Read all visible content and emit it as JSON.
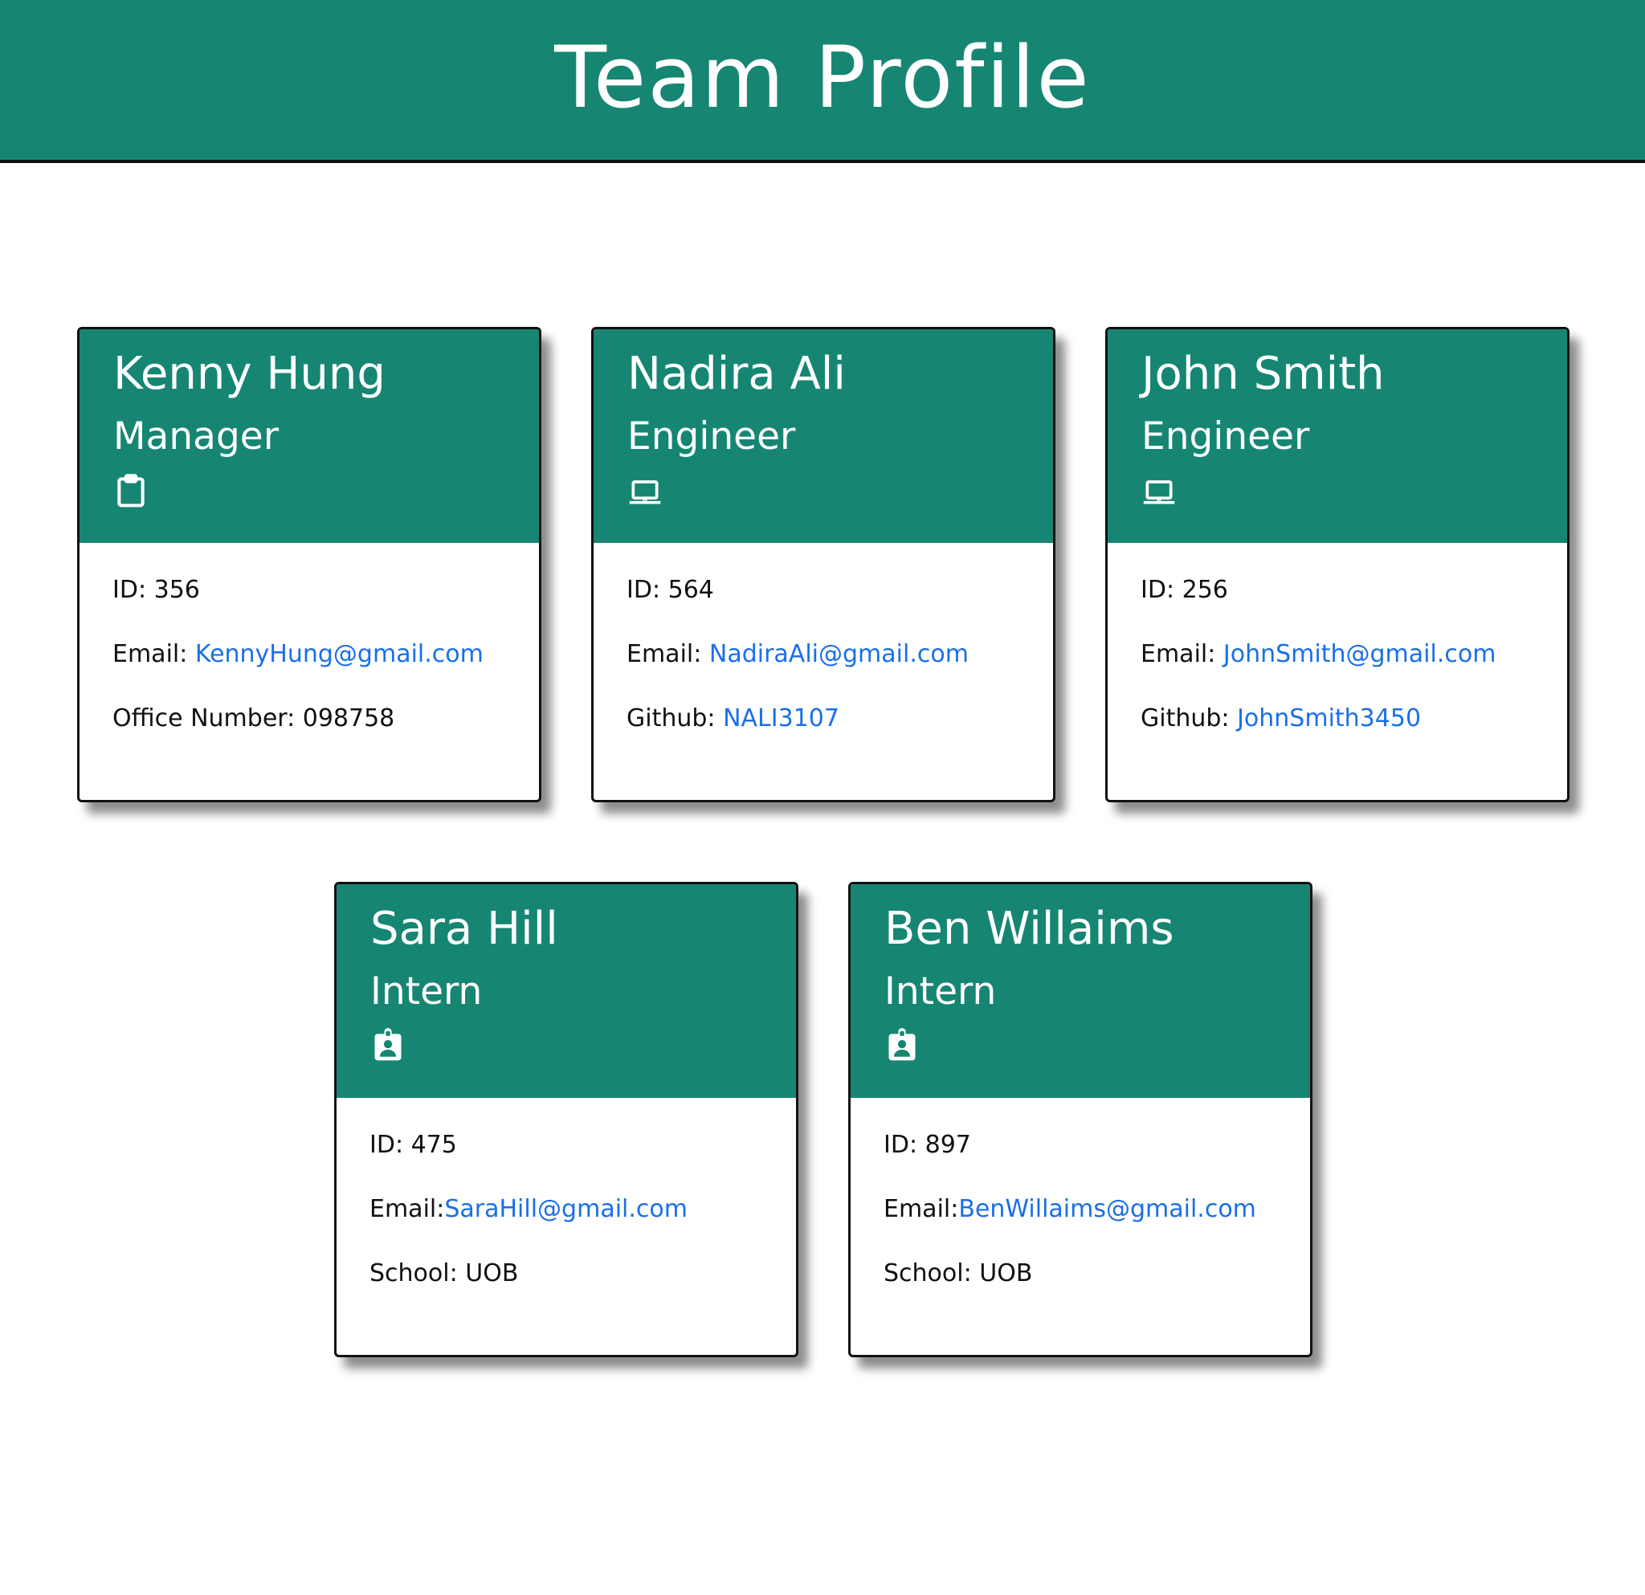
{
  "header": {
    "title": "Team Profile"
  },
  "colors": {
    "accent": "#168673",
    "link": "#1a6fe8"
  },
  "cards": [
    {
      "name": "Kenny Hung",
      "role": "Manager",
      "icon": "clipboard-icon",
      "id_label": "ID:",
      "id_value": "356",
      "email_label": "Email:",
      "email_value": "KennyHung@gmail.com",
      "extra_label": "Office Number:",
      "extra_value": "098758"
    },
    {
      "name": "Nadira Ali",
      "role": "Engineer",
      "icon": "laptop-icon",
      "id_label": "ID:",
      "id_value": "564",
      "email_label": "Email:",
      "email_value": "NadiraAli@gmail.com",
      "extra_label": "Github:",
      "extra_value": "NALI3107"
    },
    {
      "name": "John Smith",
      "role": "Engineer",
      "icon": "laptop-icon",
      "id_label": "ID:",
      "id_value": "256",
      "email_label": "Email:",
      "email_value": "JohnSmith@gmail.com",
      "extra_label": "Github:",
      "extra_value": "JohnSmith3450"
    },
    {
      "name": "Sara Hill",
      "role": "Intern",
      "icon": "id-badge-icon",
      "id_label": "ID:",
      "id_value": "475",
      "email_label": "Email:",
      "email_value": "SaraHill@gmail.com",
      "extra_label": "School:",
      "extra_value": "UOB"
    },
    {
      "name": "Ben Willaims",
      "role": "Intern",
      "icon": "id-badge-icon",
      "id_label": "ID:",
      "id_value": "897",
      "email_label": "Email:",
      "email_value": "BenWillaims@gmail.com",
      "extra_label": "School:",
      "extra_value": "UOB"
    }
  ]
}
